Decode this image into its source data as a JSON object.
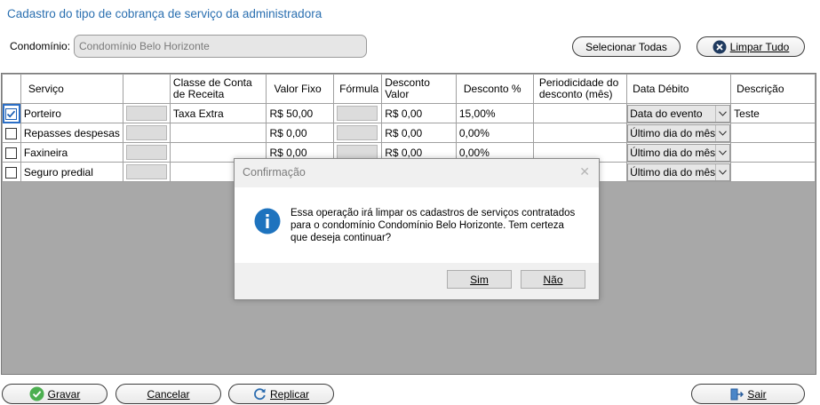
{
  "title": "Cadastro do tipo de cobrança de serviço da administradora",
  "condominio": {
    "label": "Condomínio:",
    "value": "Condomínio Belo Horizonte"
  },
  "top_buttons": {
    "select_all": "Selecionar Todas",
    "clear_all": "Limpar Tudo"
  },
  "columns": [
    "Serviço",
    "",
    "Classe de Conta de Receita",
    "Valor Fixo",
    "Fórmula",
    "Desconto Valor",
    "Desconto %",
    "Periodicidade do desconto (mês)",
    "Data Débito",
    "Descrição"
  ],
  "rows": [
    {
      "checked": true,
      "servico": "Porteiro",
      "classe": "Taxa Extra",
      "valor_fixo": "R$ 50,00",
      "desconto_valor": "R$ 0,00",
      "desconto_pct": "15,00%",
      "periodicidade": "",
      "data_debito": "Data do evento",
      "descricao": "Teste"
    },
    {
      "checked": false,
      "servico": "Repasses despesas",
      "classe": "",
      "valor_fixo": "R$ 0,00",
      "desconto_valor": "R$ 0,00",
      "desconto_pct": "0,00%",
      "periodicidade": "",
      "data_debito": "Último dia do mês",
      "descricao": ""
    },
    {
      "checked": false,
      "servico": "Faxineira",
      "classe": "",
      "valor_fixo": "R$ 0,00",
      "desconto_valor": "R$ 0,00",
      "desconto_pct": "0,00%",
      "periodicidade": "",
      "data_debito": "Último dia do mês",
      "descricao": ""
    },
    {
      "checked": false,
      "servico": "Seguro predial",
      "classe": "",
      "valor_fixo": "",
      "desconto_valor": "",
      "desconto_pct": "",
      "periodicidade": "",
      "data_debito": "Último dia do mês",
      "descricao": ""
    }
  ],
  "dialog": {
    "title": "Confirmação",
    "message": "Essa operação irá limpar os cadastros de serviços contratados para o condomínio Condomínio Belo Horizonte. Tem certeza que deseja continuar?",
    "yes_label": "Sim",
    "no_label": "Não"
  },
  "bottom_buttons": {
    "save": "Gravar",
    "cancel": "Cancelar",
    "replicate": "Replicar",
    "exit": "Sair"
  },
  "icons": {
    "clear": "close-circle-icon",
    "save": "check-circle-icon",
    "replicate": "refresh-icon",
    "exit": "door-exit-icon",
    "info": "info-icon"
  },
  "colors": {
    "title": "#2a6fb0",
    "info_blue": "#1e73be",
    "save_green": "#4caf50",
    "clear_navy": "#1f3a5f"
  }
}
